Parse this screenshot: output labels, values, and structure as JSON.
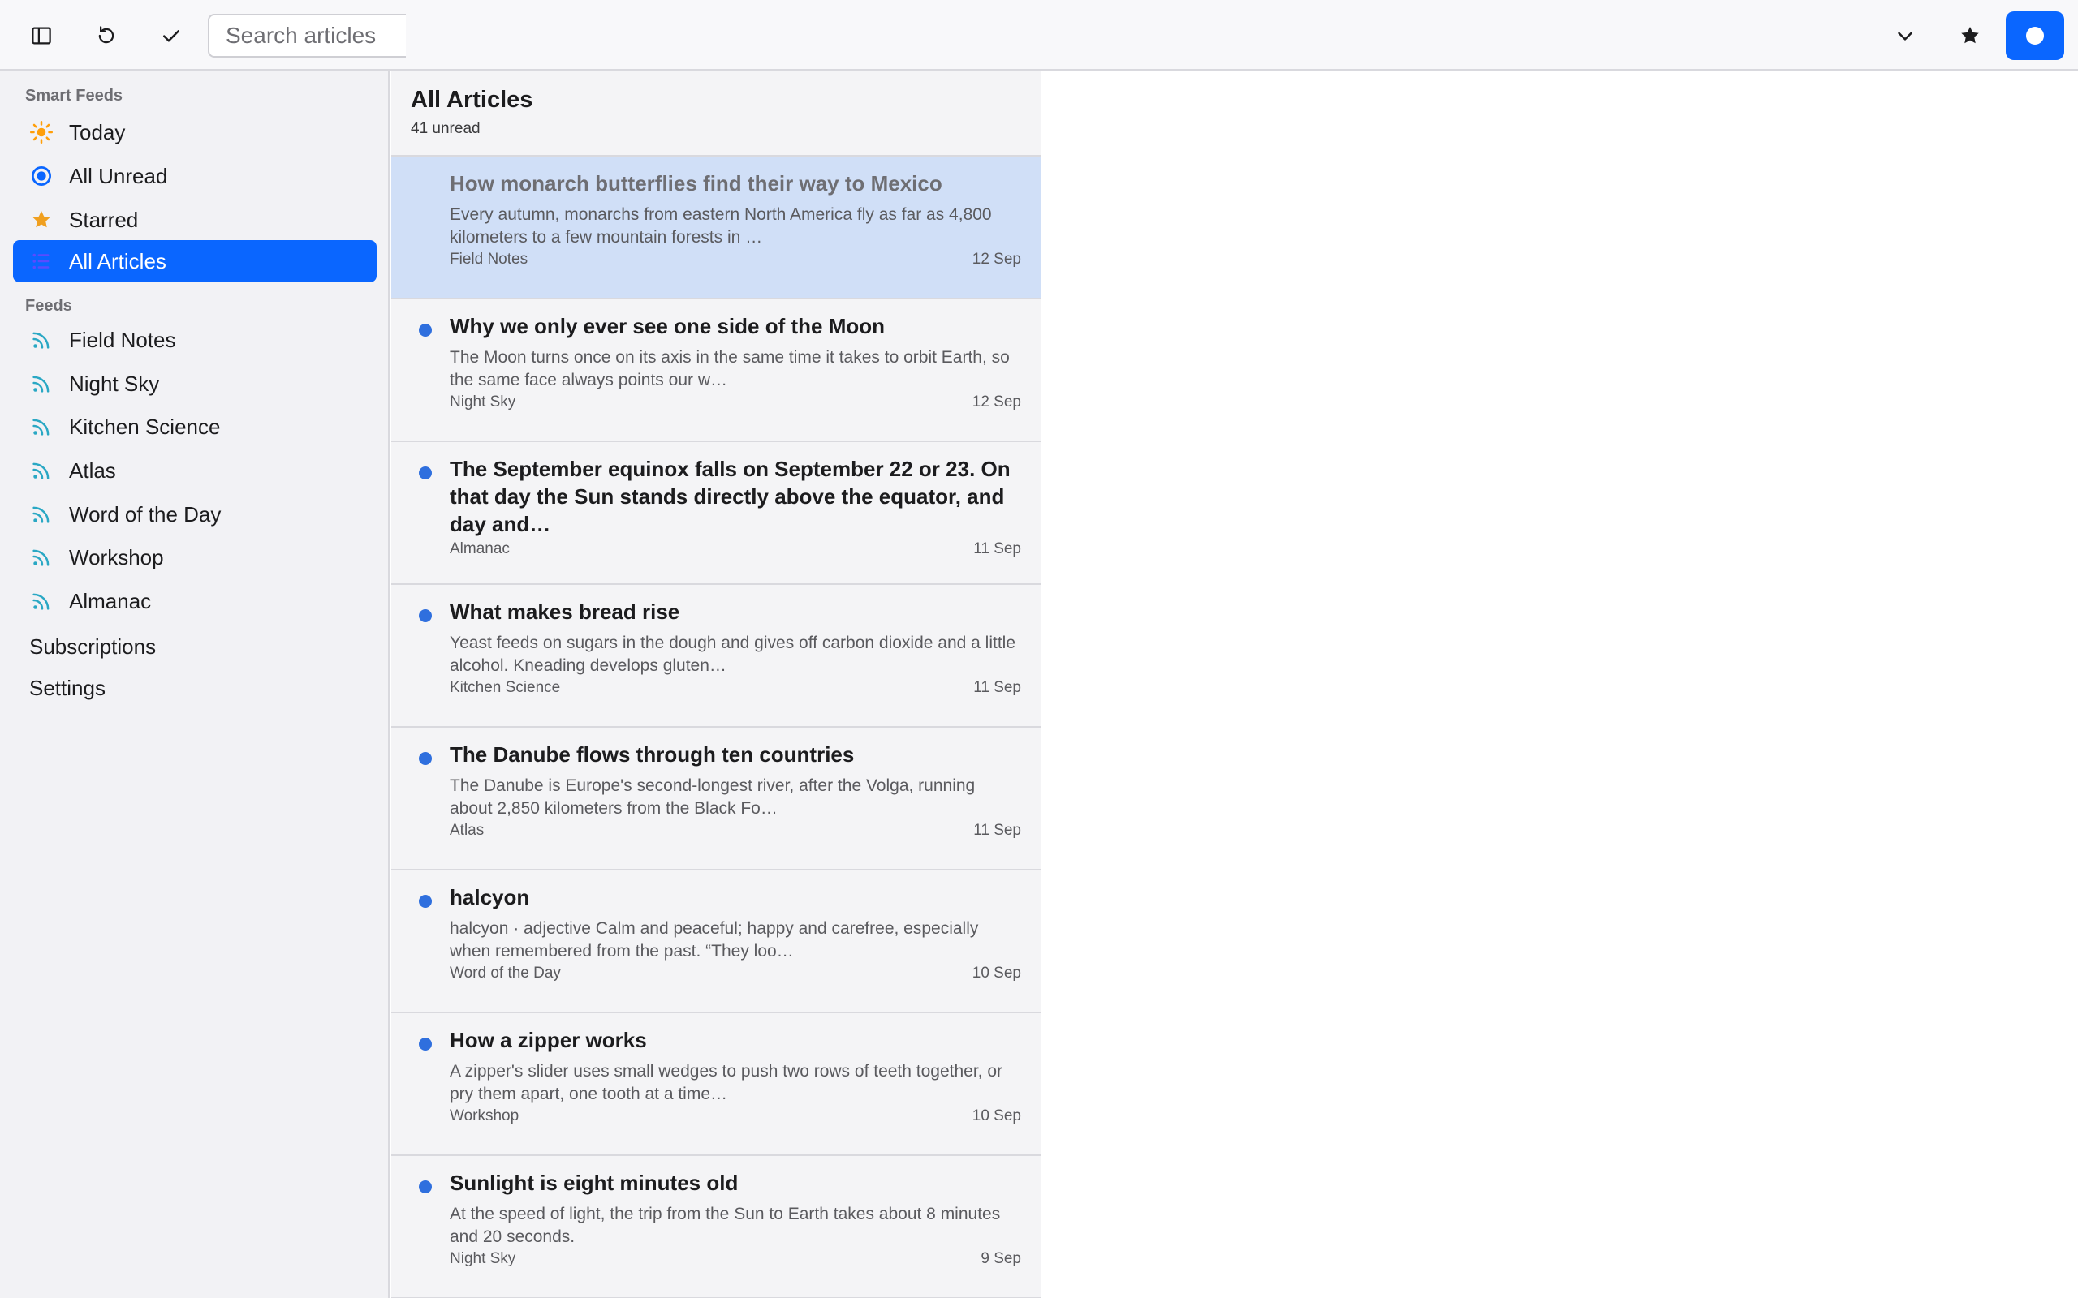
{
  "toolbar": {
    "sidebar_toggle_icon": "sidebar-toggle-icon",
    "refresh_icon": "refresh-icon",
    "mark_read_icon": "checkmark-icon",
    "search_placeholder": "Search articles",
    "dropdown_icon": "chevron-down-icon",
    "star_icon": "star-icon",
    "primary_icon": "record-icon",
    "accent_color": "#0a66ff"
  },
  "sidebar": {
    "smart_feeds_label": "Smart Feeds",
    "smart_feeds": [
      {
        "label": "Today",
        "icon": "sun-icon",
        "color": "#ff9f0a"
      },
      {
        "label": "All Unread",
        "icon": "unread-circle-icon",
        "color": "#0a66ff"
      },
      {
        "label": "Starred",
        "icon": "star-icon",
        "color": "#f0a020"
      },
      {
        "label": "All Articles",
        "icon": "list-icon",
        "color": "#5b4bff",
        "active": true
      }
    ],
    "feeds_label": "Feeds",
    "feeds": [
      {
        "label": "Field Notes",
        "icon": "rss-icon"
      },
      {
        "label": "Night Sky",
        "icon": "rss-icon"
      },
      {
        "label": "Kitchen Science",
        "icon": "rss-icon"
      },
      {
        "label": "Atlas",
        "icon": "rss-icon"
      },
      {
        "label": "Word of the Day",
        "icon": "rss-icon"
      },
      {
        "label": "Workshop",
        "icon": "rss-icon"
      },
      {
        "label": "Almanac",
        "icon": "rss-icon"
      }
    ],
    "feed_icon_color": "#2aa8c4",
    "subscriptions_label": "Subscriptions",
    "settings_label": "Settings"
  },
  "list": {
    "title": "All Articles",
    "subtitle": "41 unread",
    "unread_dot_color": "#2f6fde",
    "articles": [
      {
        "title": "How monarch butterflies find their way to Mexico",
        "summary": "Every autumn, monarchs from eastern North America fly as far as 4,800 kilometers to a few mountain forests in …",
        "source": "Field Notes",
        "date": "12 Sep",
        "unread": false,
        "selected": true
      },
      {
        "title": "Why we only ever see one side of the Moon",
        "summary": "The Moon turns once on its axis in the same time it takes to orbit Earth, so the same face always points our w…",
        "source": "Night Sky",
        "date": "12 Sep",
        "unread": true
      },
      {
        "title": "The September equinox falls on September 22 or 23. On that day the Sun stands directly above the equator, and day and…",
        "summary": "",
        "source": "Almanac",
        "date": "11 Sep",
        "unread": true
      },
      {
        "title": "What makes bread rise",
        "summary": "Yeast feeds on sugars in the dough and gives off carbon dioxide and a little alcohol. Kneading develops gluten…",
        "source": "Kitchen Science",
        "date": "11 Sep",
        "unread": true
      },
      {
        "title": "The Danube flows through ten countries",
        "summary": "The Danube is Europe's second-longest river, after the Volga, running about 2,850 kilometers from the Black Fo…",
        "source": "Atlas",
        "date": "11 Sep",
        "unread": true
      },
      {
        "title": "halcyon",
        "summary": "halcyon · adjective Calm and peaceful; happy and carefree, especially when remembered from the past. “They loo…",
        "source": "Word of the Day",
        "date": "10 Sep",
        "unread": true
      },
      {
        "title": "How a zipper works",
        "summary": "A zipper's slider uses small wedges to push two rows of teeth together, or pry them apart, one tooth at a time…",
        "source": "Workshop",
        "date": "10 Sep",
        "unread": true
      },
      {
        "title": "Sunlight is eight minutes old",
        "summary": "At the speed of light, the trip from the Sun to Earth takes about 8 minutes and 20 seconds.",
        "source": "Night Sky",
        "date": "9 Sep",
        "unread": true
      }
    ]
  }
}
